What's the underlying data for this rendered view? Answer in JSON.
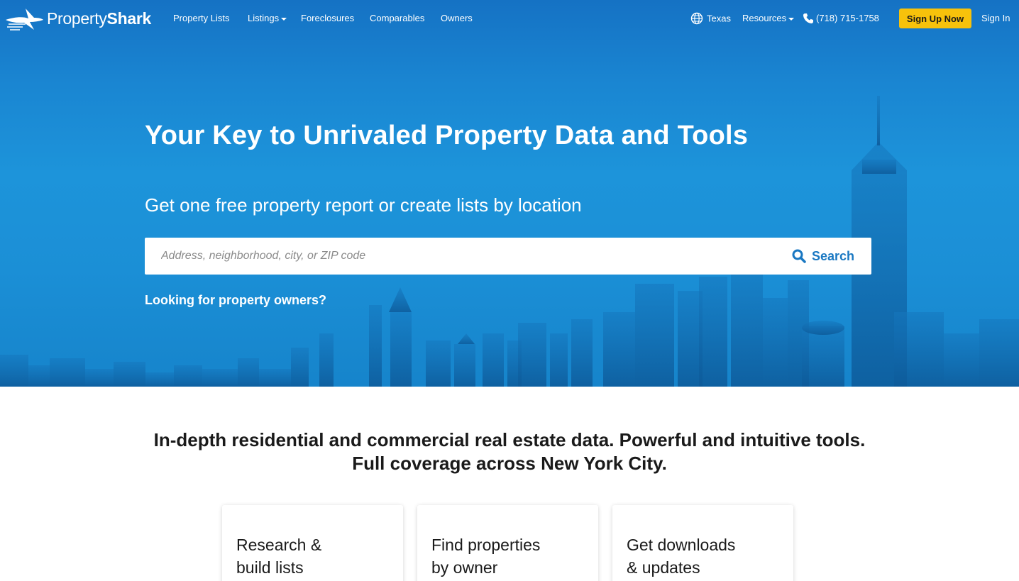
{
  "brand": {
    "name_light": "Property",
    "name_bold": "Shark"
  },
  "nav": {
    "property_lists": "Property Lists",
    "listings": "Listings",
    "foreclosures": "Foreclosures",
    "comparables": "Comparables",
    "owners": "Owners",
    "region": "Texas",
    "resources": "Resources",
    "phone": "(718) 715-1758",
    "signup": "Sign Up Now",
    "signin": "Sign In"
  },
  "hero": {
    "title": "Your Key to Unrivaled Property Data and Tools",
    "subtitle": "Get one free property report or create lists by location",
    "search_placeholder": "Address, neighborhood, city, or ZIP code",
    "search_button": "Search",
    "owners_link": "Looking for property owners?"
  },
  "tagline": {
    "line1": "In-depth residential and commercial real estate data. Powerful and intuitive tools.",
    "line2": "Full coverage across New York City."
  },
  "cards": [
    {
      "title": "Research &\nbuild lists"
    },
    {
      "title": "Find properties\nby owner"
    },
    {
      "title": "Get downloads\n& updates"
    }
  ],
  "colors": {
    "hero_blue": "#1d94da",
    "accent_yellow": "#f7c20b",
    "search_blue": "#1a78c2"
  },
  "icons": [
    "globe-icon",
    "phone-icon",
    "search-icon",
    "shark-logo-icon"
  ]
}
